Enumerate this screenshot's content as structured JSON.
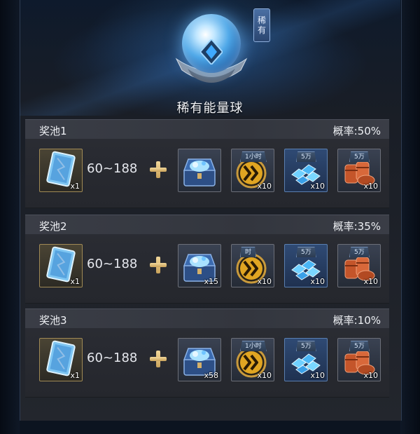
{
  "header": {
    "title": "稀有能量球",
    "rarity_tag": [
      "稀",
      "有"
    ]
  },
  "pools": [
    {
      "name": "奖池1",
      "probability": "概率:50%",
      "range": "60~188",
      "main_qty": "x1",
      "chest_qty": "",
      "boost_tag": "1小时",
      "boost_qty": "x10",
      "crystal_tag": "5万",
      "crystal_qty": "x10",
      "barrel_tag": "5万",
      "barrel_qty": "x10"
    },
    {
      "name": "奖池2",
      "probability": "概率:35%",
      "range": "60~188",
      "main_qty": "x1",
      "chest_qty": "x15",
      "boost_tag": "时",
      "boost_qty": "x10",
      "crystal_tag": "5万",
      "crystal_qty": "x10",
      "barrel_tag": "5万",
      "barrel_qty": "x10"
    },
    {
      "name": "奖池3",
      "probability": "概率:10%",
      "range": "60~188",
      "main_qty": "x1",
      "chest_qty": "x58",
      "boost_tag": "1小时",
      "boost_qty": "x10",
      "crystal_tag": "5万",
      "crystal_qty": "x10",
      "barrel_tag": "5万",
      "barrel_qty": "x10"
    }
  ],
  "icons": {
    "main_item": "energy-card-icon",
    "chest": "treasure-chest-icon",
    "boost": "speedup-chevron-icon",
    "crystal": "blue-crystal-icon",
    "barrel": "oil-barrel-icon",
    "plus": "plus-icon"
  },
  "colors": {
    "accent_gold": "#d9b56e",
    "panel_bg": "#25272d",
    "header_bg": "#3a3d46"
  }
}
